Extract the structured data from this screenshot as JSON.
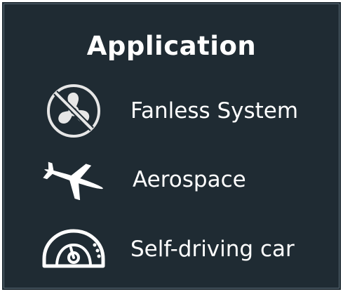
{
  "panel": {
    "title": "Application",
    "background_color": "#1f2b33",
    "text_color": "#ffffff"
  },
  "items": [
    {
      "label": "Fanless System",
      "icon": "no-fan-icon"
    },
    {
      "label": "Aerospace",
      "icon": "airplane-icon"
    },
    {
      "label": "Self-driving car",
      "icon": "speedometer-icon"
    }
  ]
}
